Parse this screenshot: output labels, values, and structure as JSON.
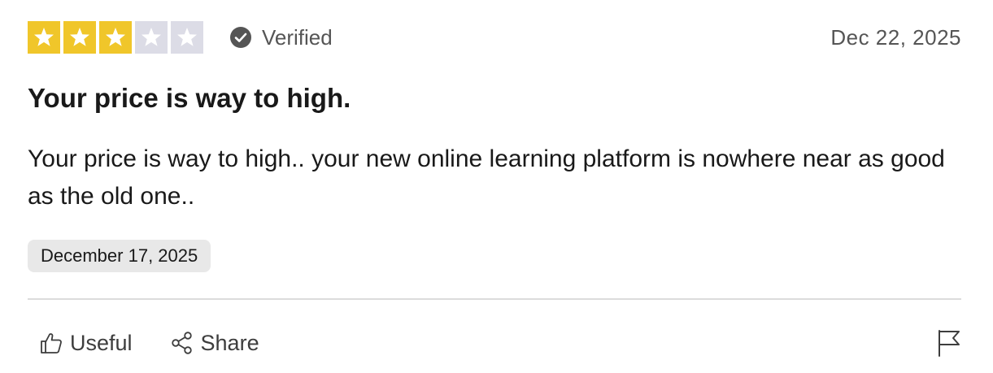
{
  "review": {
    "rating": 3,
    "rating_max": 5,
    "verified_label": "Verified",
    "review_date": "Dec 22, 2025",
    "title": "Your price is way to high.",
    "body": "Your price is way to high.. your new online learning platform is nowhere near as good as the old one..",
    "experience_date": "December 17, 2025"
  },
  "actions": {
    "useful_label": "Useful",
    "share_label": "Share"
  },
  "icons": {
    "star": "star-icon",
    "verified": "check-circle-icon",
    "useful": "thumbs-up-icon",
    "share": "share-icon",
    "report": "flag-icon"
  },
  "colors": {
    "star_filled_bg": "#f0c62a",
    "star_empty_bg": "#dcdce6",
    "star_glyph": "#ffffff",
    "chip_bg": "#e8e8e8",
    "muted_text": "#555555"
  }
}
